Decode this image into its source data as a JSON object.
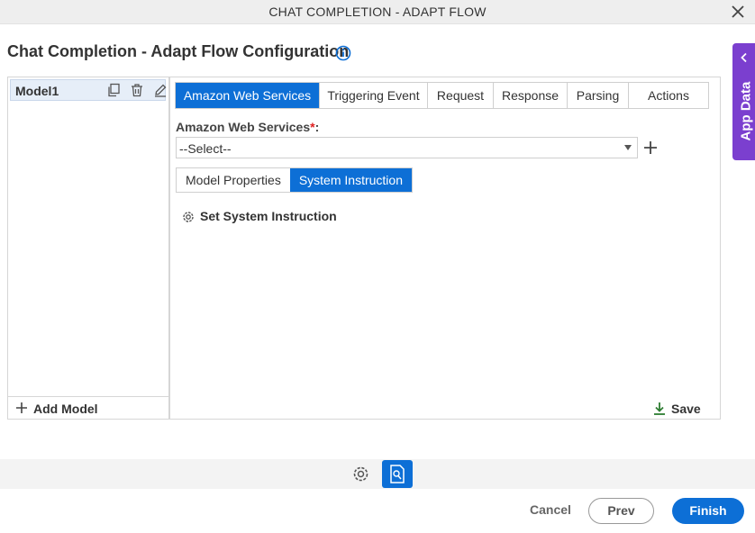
{
  "window": {
    "title": "CHAT COMPLETION - ADAPT FLOW"
  },
  "page": {
    "title": "Chat Completion - Adapt Flow Configuration"
  },
  "models": {
    "items": [
      {
        "label": "Model1"
      }
    ],
    "add_label": "Add Model"
  },
  "tabs": [
    {
      "label": "Amazon Web Services",
      "active": true
    },
    {
      "label": "Triggering Event",
      "active": false
    },
    {
      "label": "Request",
      "active": false
    },
    {
      "label": "Response",
      "active": false
    },
    {
      "label": "Parsing",
      "active": false
    },
    {
      "label": "Actions",
      "active": false
    }
  ],
  "aws_field": {
    "label": "Amazon Web Services",
    "required_mark": "*",
    "colon": ":",
    "value": "--Select--"
  },
  "subtabs": [
    {
      "label": "Model Properties",
      "active": false
    },
    {
      "label": "System Instruction",
      "active": true
    }
  ],
  "system_instruction": {
    "label": "Set System Instruction"
  },
  "save": {
    "label": "Save"
  },
  "side_panel": {
    "label": "App Data"
  },
  "footer": {
    "cancel_label": "Cancel",
    "prev_label": "Prev",
    "finish_label": "Finish"
  },
  "colors": {
    "accent": "#0d6fd6",
    "app_data": "#7b3fcf",
    "required": "#e02020",
    "save_icon": "#2e7d32"
  }
}
